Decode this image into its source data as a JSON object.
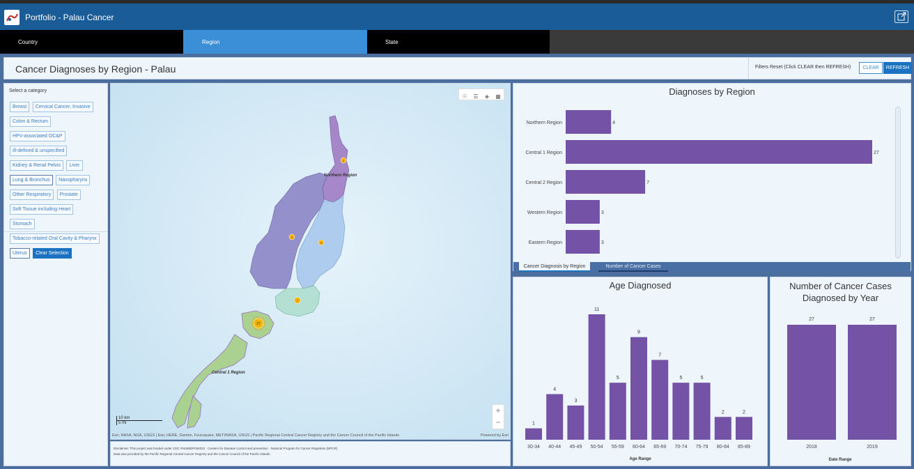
{
  "header": {
    "title": "Portfolio - Palau Cancer"
  },
  "nav_tabs": [
    {
      "label": "Country"
    },
    {
      "label": "Region"
    },
    {
      "label": "State"
    }
  ],
  "page_title": "Cancer Diagnoses by Region - Palau",
  "filters": {
    "label": "Filters Reset (Click CLEAR then REFRESH)",
    "clear_label": "CLEAR",
    "refresh_label": "REFRESH"
  },
  "categories": {
    "prompt": "Select a category",
    "items": [
      "Breast",
      "Cervical Cancer, Invasive",
      "Colon & Rectum",
      "HPV-associated OC&P",
      "Ill-defined & unspecified",
      "Kidney & Renal Pelvis",
      "Liver",
      "Lung & Bronchus",
      "Nasopharynx",
      "Other Respiratory",
      "Prostate",
      "Soft Tissue including Heart",
      "Stomach",
      "Tobacco-related Oral Cavity & Pharynx",
      "Uterus"
    ],
    "clear_selection": "Clear Selection"
  },
  "map": {
    "labels": {
      "northern": "Northern Region",
      "central1": "Central 1 Region"
    },
    "markers": [
      "4",
      "3",
      "3",
      "7",
      "27"
    ],
    "scale_km": "10 km",
    "scale_mi": "5 mi",
    "attribution": "Esri, NASA, NGA, USGS | Esri, HERE, Garmin, Foursquare, METI/NASA, USGS | Pacific Regional Central Cancer Registry and the Cancer Council of the Pacific Islands",
    "powered_by": "Powered by Esri",
    "zoom_in": "+",
    "zoom_out": "−"
  },
  "disclaimer": {
    "line1": "Disclaimer: This project was funded under CDC #NU58DP006312 · Centers for Disease Control and prevention · National Program for Cancer Registries (NPCR)",
    "line2": "Data was provided by the Pacific Regional Central Cancer Registry and the Cancer Council of the Pacific Islands."
  },
  "region_tabs": [
    {
      "label": "Cancer Diagnosis by Region"
    },
    {
      "label": "Number of Cancer Cases"
    }
  ],
  "colors": {
    "bar": "#7452a5",
    "header": "#1a5c97",
    "accent": "#3b8fd6"
  },
  "chart_data": [
    {
      "type": "bar",
      "orientation": "horizontal",
      "title": "Diagnoses by Region",
      "categories": [
        "Northern Region",
        "Central 1 Region",
        "Central 2 Region",
        "Western Region",
        "Eastern Region"
      ],
      "values": [
        4,
        27,
        7,
        3,
        3
      ],
      "xlim": [
        0,
        27
      ]
    },
    {
      "type": "bar",
      "title": "Age Diagnosed",
      "xlabel": "Age Range",
      "categories": [
        "30-34",
        "40-44",
        "45-49",
        "50-54",
        "55-59",
        "60-64",
        "65-69",
        "70-74",
        "75-79",
        "80-84",
        "85-89"
      ],
      "values": [
        1,
        4,
        3,
        11,
        5,
        9,
        7,
        5,
        5,
        2,
        2
      ],
      "ylim": [
        0,
        11
      ]
    },
    {
      "type": "bar",
      "title": "Number of Cancer Cases Diagnosed by Year",
      "xlabel": "Date Range",
      "categories": [
        "2018",
        "2019"
      ],
      "values": [
        27,
        27
      ],
      "ylim": [
        0,
        27
      ]
    }
  ]
}
